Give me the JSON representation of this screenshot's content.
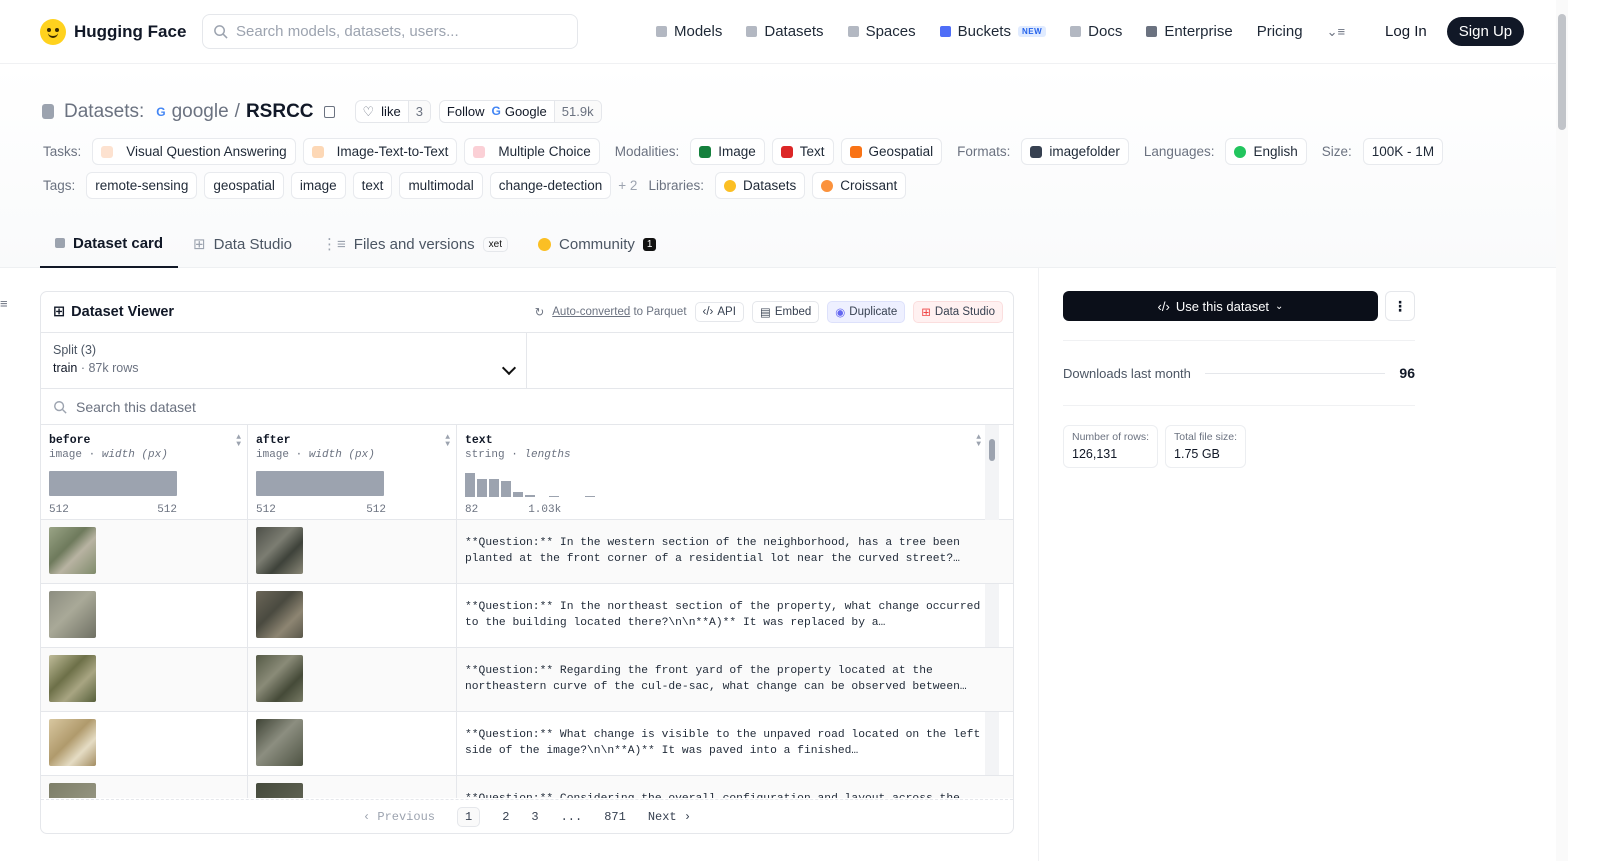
{
  "header": {
    "brand": "Hugging Face",
    "search_placeholder": "Search models, datasets, users...",
    "nav": [
      "Models",
      "Datasets",
      "Spaces",
      "Buckets",
      "Docs",
      "Enterprise",
      "Pricing"
    ],
    "new_badge": "NEW",
    "login": "Log In",
    "signup": "Sign Up"
  },
  "dataset": {
    "prefix": "Datasets:",
    "owner": "google",
    "sep": "/",
    "name": "RSRCC",
    "like_label": "like",
    "like_count": "3",
    "follow_label": "Follow",
    "follow_org": "Google",
    "follow_count": "51.9k"
  },
  "tags": {
    "tasks_label": "Tasks:",
    "tasks": [
      "Visual Question Answering",
      "Image-Text-to-Text",
      "Multiple Choice"
    ],
    "modalities_label": "Modalities:",
    "modalities": [
      "Image",
      "Text",
      "Geospatial"
    ],
    "formats_label": "Formats:",
    "formats": [
      "imagefolder"
    ],
    "languages_label": "Languages:",
    "languages": [
      "English"
    ],
    "size_label": "Size:",
    "size": "100K - 1M",
    "tags_label": "Tags:",
    "tags": [
      "remote-sensing",
      "geospatial",
      "image",
      "text",
      "multimodal",
      "change-detection"
    ],
    "more_tags": "+ 2",
    "libraries_label": "Libraries:",
    "libraries": [
      "Datasets",
      "Croissant"
    ]
  },
  "tabs": {
    "card": "Dataset card",
    "studio": "Data Studio",
    "files": "Files and versions",
    "xet": "xet",
    "community": "Community",
    "community_count": "1"
  },
  "viewer": {
    "title": "Dataset Viewer",
    "auto_converted": "Auto-converted",
    "to_parquet": "to Parquet",
    "api": "API",
    "embed": "Embed",
    "duplicate": "Duplicate",
    "data_studio": "Data Studio",
    "split_label": "Split (3)",
    "split_value": "train",
    "split_rows": "87k rows",
    "search_placeholder": "Search this dataset",
    "columns": [
      {
        "name": "before",
        "type": "image",
        "meta": "width (px)",
        "min": "512",
        "max": "512"
      },
      {
        "name": "after",
        "type": "image",
        "meta": "width (px)",
        "min": "512",
        "max": "512"
      },
      {
        "name": "text",
        "type": "string",
        "meta": "lengths",
        "min": "82",
        "max": "1.03k"
      }
    ],
    "rows": [
      {
        "text": "**Question:** In the western section of the neighborhood, has a tree been planted at the front corner of a residential lot near the curved street?…"
      },
      {
        "text": "**Question:** In the northeast section of the property, what change occurred to the building located there?\\n\\n**A)** It was replaced by a…"
      },
      {
        "text": "**Question:** Regarding the front yard of the property located at the northeastern curve of the cul-de-sac, what change can be observed between…"
      },
      {
        "text": "**Question:** What change is visible to the unpaved road located on the left side of the image?\\n\\n**A)** It was paved into a finished…"
      },
      {
        "text": "**Question:** Considering the overall configuration and layout across the"
      }
    ],
    "pager": {
      "prev": "Previous",
      "pages": [
        "1",
        "2",
        "3",
        "...",
        "871"
      ],
      "next": "Next"
    }
  },
  "sidebar": {
    "use_dataset": "Use this dataset",
    "downloads_label": "Downloads last month",
    "downloads": "96",
    "rows_label": "Number of rows:",
    "rows": "126,131",
    "size_label": "Total file size:",
    "size": "1.75 GB"
  }
}
